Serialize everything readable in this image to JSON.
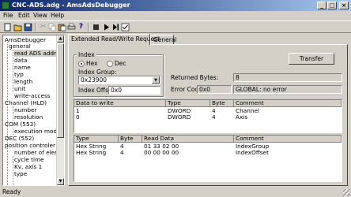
{
  "window": {
    "title": "CNC-ADS.adg - AmsAdsDebugger"
  },
  "menu": [
    "File",
    "Edit",
    "View",
    "Help"
  ],
  "tree": {
    "nodes": [
      {
        "label": "AmsDebugger"
      },
      {
        "label": "general"
      },
      {
        "label": "read ADS address",
        "selected": true
      },
      {
        "label": "data"
      },
      {
        "label": "name"
      },
      {
        "label": "typ"
      },
      {
        "label": "length"
      },
      {
        "label": "unit"
      },
      {
        "label": "write-access"
      },
      {
        "label": "Channel (HLD)"
      },
      {
        "label": "number"
      },
      {
        "label": "resolution"
      },
      {
        "label": "COM (553)"
      },
      {
        "label": "execution mode"
      },
      {
        "label": "DEC (552)"
      },
      {
        "label": "position controler"
      },
      {
        "label": "number of element"
      },
      {
        "label": "cycle time"
      },
      {
        "label": "Kv, axis 1"
      },
      {
        "label": "type"
      }
    ]
  },
  "tabs": [
    {
      "label": "Extended Read/Write Request",
      "active": true
    },
    {
      "label": "General",
      "active": false
    }
  ],
  "index": {
    "group_label": "Index",
    "hex_label": "Hex",
    "dec_label": "Dec",
    "mode": "Hex",
    "index_group_label": "Index Group:",
    "index_group_value": "0x23900",
    "index_offset_label": "Index Offset:",
    "index_offset_value": "0x0"
  },
  "transfer_button": "Transfer",
  "result": {
    "returned_bytes_label": "Returned Bytes:",
    "returned_bytes_value": "8",
    "error_code_label": "Error Code:",
    "error_code_value": "0x0",
    "error_text": "GLOBAL: no error"
  },
  "write_table": {
    "headers": [
      "Data to write",
      "Type",
      "Byte",
      "Comment"
    ],
    "rows": [
      [
        "1",
        "DWORD",
        "4",
        "Channel"
      ],
      [
        "0",
        "DWORD",
        "4",
        "Axis"
      ]
    ]
  },
  "read_table": {
    "headers": [
      "Type",
      "Byte",
      "Read Data",
      "Comment"
    ],
    "rows": [
      [
        "Hex String",
        "4",
        "01 33 02 00",
        "IndexGroup"
      ],
      [
        "Hex String",
        "4",
        "00 00 00 00",
        "IndexOffset"
      ]
    ]
  },
  "status": {
    "text": "Ready"
  }
}
